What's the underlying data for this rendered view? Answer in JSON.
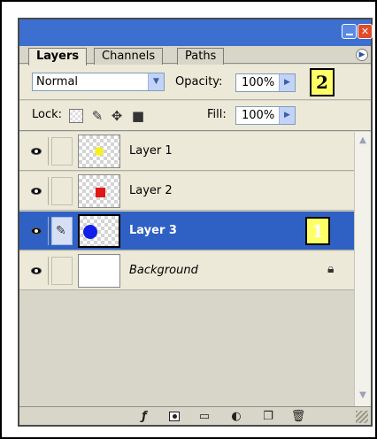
{
  "window": {
    "minimize_icon": "minimize-icon",
    "close_label": "✕"
  },
  "tabs": [
    {
      "label": "Layers",
      "active": true
    },
    {
      "label": "Channels",
      "active": false
    },
    {
      "label": "Paths",
      "active": false
    }
  ],
  "options": {
    "blend_mode": "Normal",
    "opacity_label": "Opacity:",
    "opacity_value": "100%",
    "lock_label": "Lock:",
    "fill_label": "Fill:",
    "fill_value": "100%"
  },
  "callouts": {
    "one": "1",
    "two": "2"
  },
  "layers": [
    {
      "name": "Layer 1",
      "visible": true,
      "selected": false,
      "swatch": "#f7f020"
    },
    {
      "name": "Layer 2",
      "visible": true,
      "selected": false,
      "swatch": "#e01818"
    },
    {
      "name": "Layer 3",
      "visible": true,
      "selected": true,
      "swatch": "#1020e8"
    },
    {
      "name": "Background",
      "visible": true,
      "selected": false,
      "locked": true
    }
  ],
  "bottom_icons": [
    "layer-style-icon",
    "layer-mask-icon",
    "new-group-icon",
    "adjustment-layer-icon",
    "new-layer-icon",
    "trash-icon"
  ],
  "colors": {
    "titlebar": "#3c6fd0",
    "selection": "#2f61c4",
    "callout": "#ffff66"
  }
}
